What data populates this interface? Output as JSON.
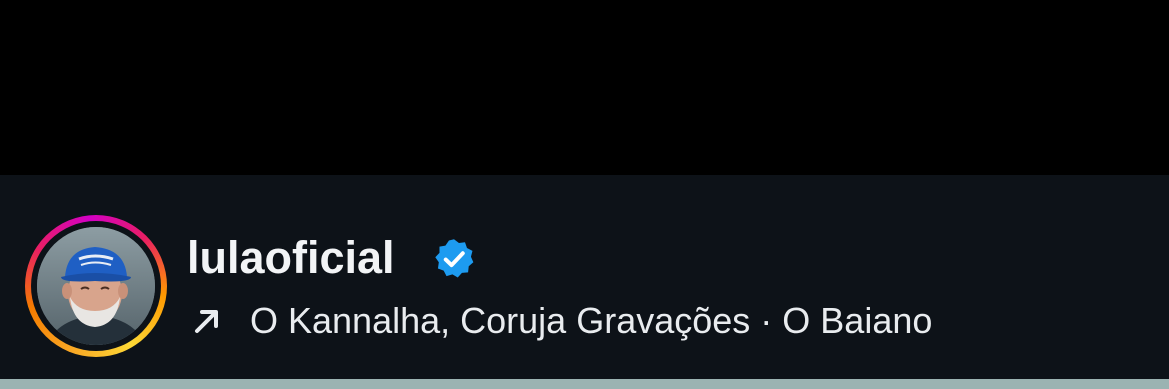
{
  "post_header": {
    "username": "lulaoficial",
    "verified_icon": "verified-badge-icon",
    "avatar_icon": "profile-avatar",
    "audio": {
      "icon": "arrow-up-right-icon",
      "artists": "O Kannalha, Coruja Gravações",
      "separator": "·",
      "track": "O Baiano"
    }
  },
  "colors": {
    "background": "#0d1218",
    "top_area": "#000000",
    "text_primary": "#f2f4f6",
    "verified_blue": "#1d9bf0"
  }
}
